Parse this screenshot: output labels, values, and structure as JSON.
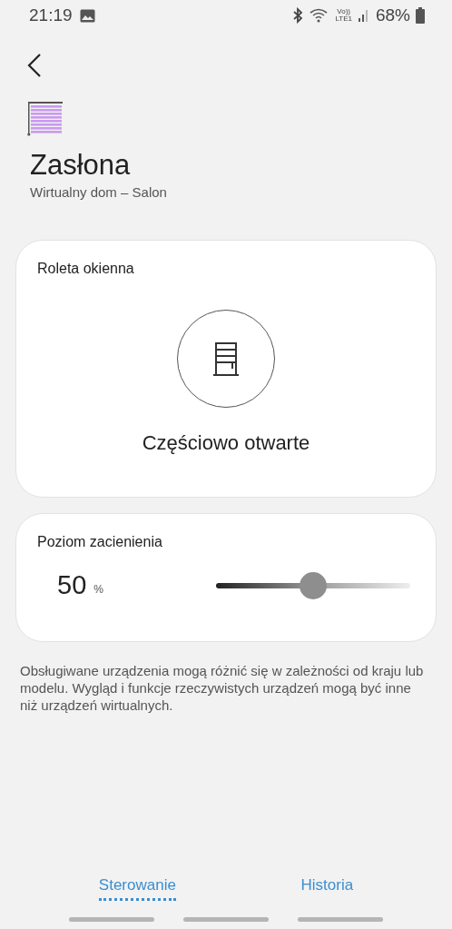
{
  "status_bar": {
    "time": "21:19",
    "network": "Vo))\nLTE1",
    "battery": "68%"
  },
  "device": {
    "name": "Zasłona",
    "location": "Wirtualny dom – Salon"
  },
  "state_card": {
    "title": "Roleta okienna",
    "status": "Częściowo otwarte"
  },
  "shade_card": {
    "title": "Poziom zacienienia",
    "value": "50",
    "unit": "%",
    "level": 0.5
  },
  "note": "Obsługiwane urządzenia mogą różnić się w zależności od kraju lub modelu. Wygląd i funkcje rzeczywistych urządzeń mogą być inne niż urządzeń wirtualnych.",
  "tabs": [
    {
      "label": "Sterowanie",
      "selected": true
    },
    {
      "label": "Historia",
      "selected": false
    }
  ]
}
